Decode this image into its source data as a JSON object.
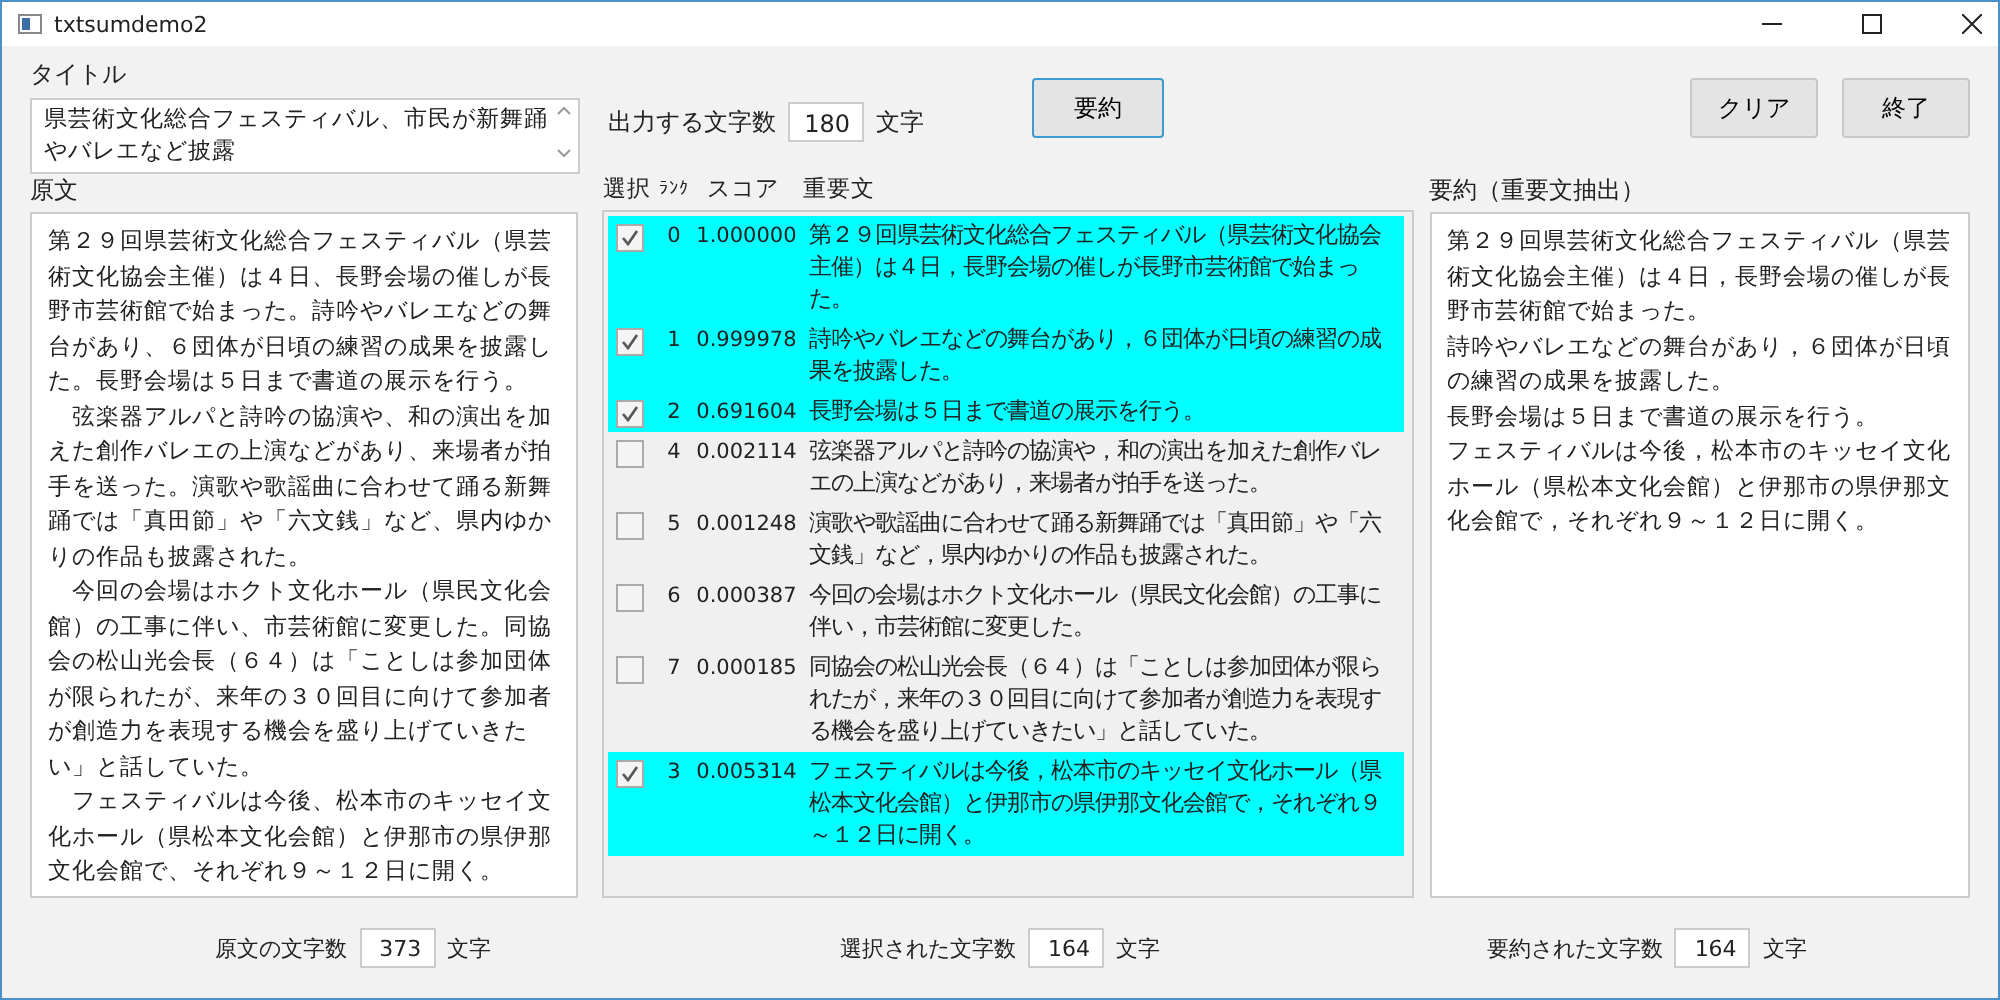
{
  "window": {
    "title": "txtsumdemo2"
  },
  "title_field": {
    "label": "タイトル",
    "value": "県芸術文化総合フェスティバル、市民が新舞踊やバレエなど披露"
  },
  "output_length": {
    "label": "出力する文字数",
    "value": "180",
    "unit": "文字"
  },
  "buttons": {
    "summarize": "要約",
    "clear": "クリア",
    "exit": "終了"
  },
  "source": {
    "label": "原文",
    "paragraphs": [
      "第２９回県芸術文化総合フェスティバル（県芸術文化協会主催）は４日、長野会場の催しが長野市芸術館で始まった。詩吟やバレエなどの舞台があり、６団体が日頃の練習の成果を披露した。長野会場は５日まで書道の展示を行う。",
      "　弦楽器アルパと詩吟の協演や、和の演出を加えた創作バレエの上演などがあり、来場者が拍手を送った。演歌や歌謡曲に合わせて踊る新舞踊では「真田節」や「六文銭」など、県内ゆかりの作品も披露された。",
      "　今回の会場はホクト文化ホール（県民文化会館）の工事に伴い、市芸術館に変更した。同協会の松山光会長（６４）は「ことしは参加団体が限られたが、来年の３０回目に向けて参加者が創造力を表現する機会を盛り上げていきたい」と話していた。",
      "　フェスティバルは今後、松本市のキッセイ文化ホール（県松本文化会館）と伊那市の県伊那文化会館で、それぞれ９～１２日に開く。"
    ]
  },
  "sentences": {
    "columns": [
      "選択",
      "ﾗﾝｸ",
      "スコア",
      "重要文"
    ],
    "rows": [
      {
        "selected": true,
        "rank": "0",
        "score": "1.000000",
        "text": "第２９回県芸術文化総合フェスティバル（県芸術文化協会主催）は４日，長野会場の催しが長野市芸術館で始まった。"
      },
      {
        "selected": true,
        "rank": "1",
        "score": "0.999978",
        "text": "詩吟やバレエなどの舞台があり，６団体が日頃の練習の成果を披露した。"
      },
      {
        "selected": true,
        "rank": "2",
        "score": "0.691604",
        "text": "長野会場は５日まで書道の展示を行う。"
      },
      {
        "selected": false,
        "rank": "4",
        "score": "0.002114",
        "text": "弦楽器アルパと詩吟の協演や，和の演出を加えた創作バレエの上演などがあり，来場者が拍手を送った。"
      },
      {
        "selected": false,
        "rank": "5",
        "score": "0.001248",
        "text": "演歌や歌謡曲に合わせて踊る新舞踊では「真田節」や「六文銭」など，県内ゆかりの作品も披露された。"
      },
      {
        "selected": false,
        "rank": "6",
        "score": "0.000387",
        "text": "今回の会場はホクト文化ホール（県民文化会館）の工事に伴い，市芸術館に変更した。"
      },
      {
        "selected": false,
        "rank": "7",
        "score": "0.000185",
        "text": "同協会の松山光会長（６４）は「ことしは参加団体が限られたが，来年の３０回目に向けて参加者が創造力を表現する機会を盛り上げていきたい」と話していた。"
      },
      {
        "selected": true,
        "rank": "3",
        "score": "0.005314",
        "text": "フェスティバルは今後，松本市のキッセイ文化ホール（県松本文化会館）と伊那市の県伊那文化会館で，それぞれ９～１２日に開く。"
      }
    ]
  },
  "summary": {
    "label": "要約（重要文抽出）",
    "lines": [
      "第２９回県芸術文化総合フェスティバル（県芸術文化協会主催）は４日，長野会場の催しが長野市芸術館で始まった。",
      "詩吟やバレエなどの舞台があり，６団体が日頃の練習の成果を披露した。",
      "長野会場は５日まで書道の展示を行う。",
      "フェスティバルは今後，松本市のキッセイ文化ホール（県松本文化会館）と伊那市の県伊那文化会館で，それぞれ９～１２日に開く。"
    ]
  },
  "counts": [
    {
      "label": "原文の文字数",
      "value": "373",
      "unit": "文字"
    },
    {
      "label": "選択された文字数",
      "value": "164",
      "unit": "文字"
    },
    {
      "label": "要約された文字数",
      "value": "164",
      "unit": "文字"
    }
  ]
}
